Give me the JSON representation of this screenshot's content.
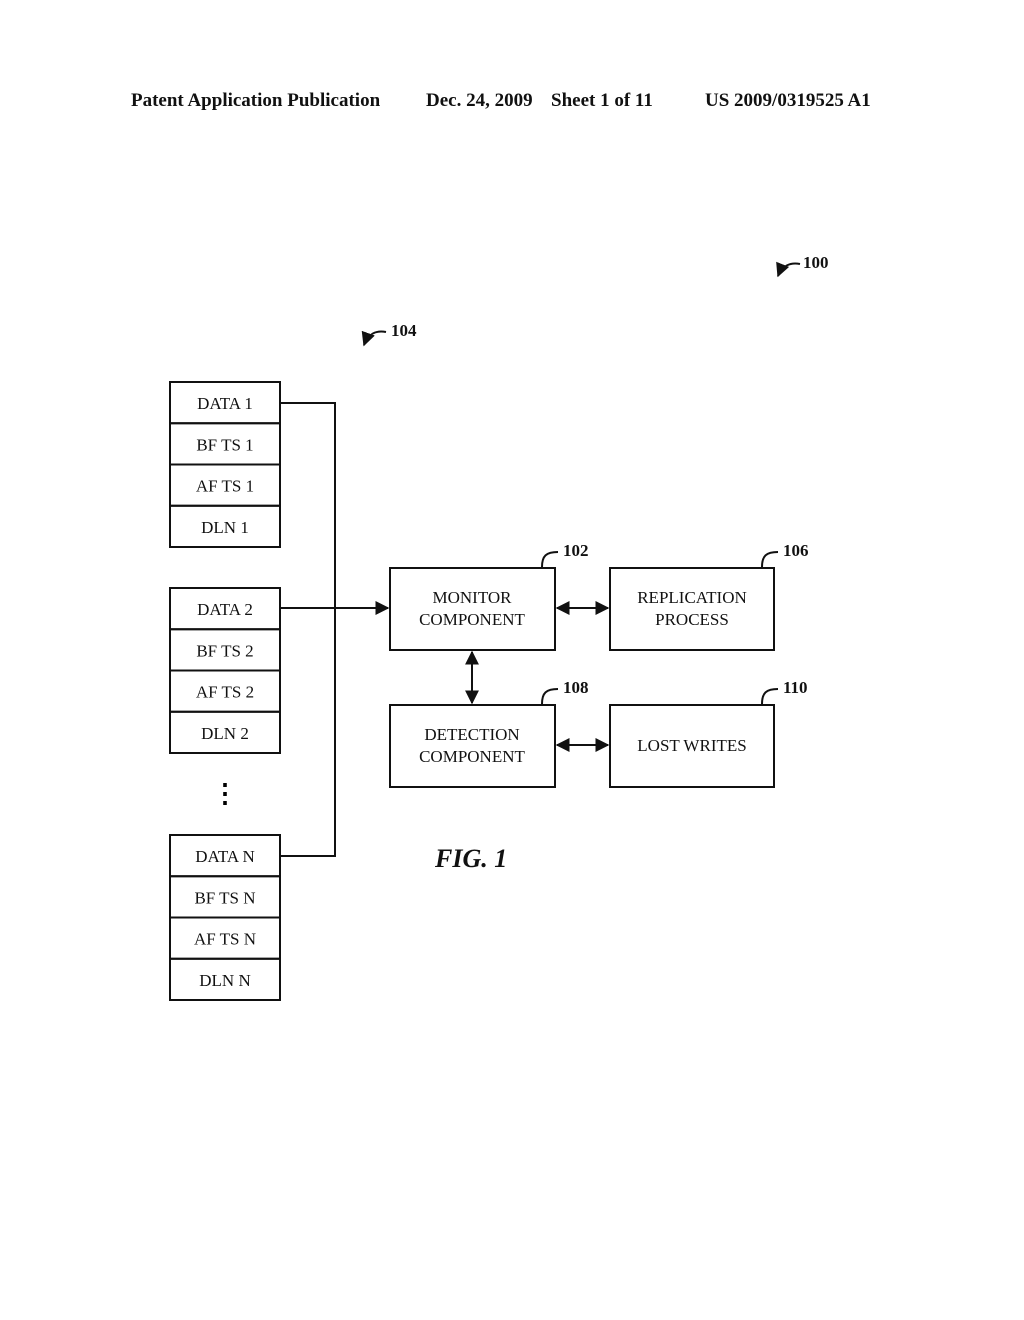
{
  "header": {
    "publication": "Patent Application Publication",
    "date": "Dec. 24, 2009",
    "sheet": "Sheet 1 of 11",
    "number": "US 2009/0319525 A1"
  },
  "figure": {
    "label": "FIG. 1",
    "refs": {
      "system": "100",
      "data_group": "104"
    },
    "data_stacks": [
      {
        "cells": [
          "DATA 1",
          "BF TS 1",
          "AF TS 1",
          "DLN 1"
        ]
      },
      {
        "cells": [
          "DATA 2",
          "BF TS 2",
          "AF TS 2",
          "DLN 2"
        ]
      },
      {
        "cells": [
          "DATA N",
          "BF TS N",
          "AF TS N",
          "DLN N"
        ]
      }
    ],
    "ellipsis": "⋮",
    "components": {
      "monitor": {
        "ref": "102",
        "lines": [
          "MONITOR",
          "COMPONENT"
        ]
      },
      "replication": {
        "ref": "106",
        "lines": [
          "REPLICATION",
          "PROCESS"
        ]
      },
      "detection": {
        "ref": "108",
        "lines": [
          "DETECTION",
          "COMPONENT"
        ]
      },
      "lost_writes": {
        "ref": "110",
        "lines": [
          "LOST WRITES"
        ]
      }
    }
  }
}
